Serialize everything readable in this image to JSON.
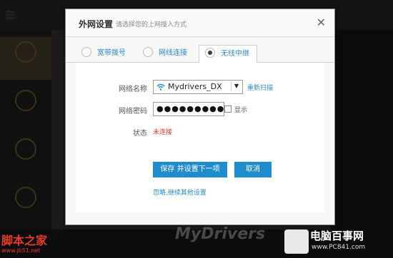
{
  "modal": {
    "title": "外网设置",
    "subtitle": "请选择您的上网接入方式",
    "close_symbol": "✕"
  },
  "tabs": [
    {
      "label": "宽带拨号",
      "selected": false
    },
    {
      "label": "网线连接",
      "selected": false
    },
    {
      "label": "无线中继",
      "selected": true
    }
  ],
  "form": {
    "ssid_label": "网络名称",
    "ssid_value": "Mydrivers_DX",
    "rescan_label": "重新扫描",
    "password_label": "网络密码",
    "password_value": "●●●●●●●●●●●●",
    "show_label": "显示",
    "status_label": "状态",
    "status_value": "未连接"
  },
  "buttons": {
    "save_next": "保存 并设置下一项",
    "cancel": "取消",
    "skip": "忽略,继续其他设置"
  },
  "watermarks": {
    "left_cn": "脚本之家",
    "left_url": "www.jb51.net",
    "right_cn": "电脑百事网",
    "right_url": "www.PC841.com",
    "center": "MyDrivers"
  },
  "colors": {
    "accent": "#1f8ccc",
    "link": "#2b8ac9",
    "status_error": "#e23a2a"
  }
}
